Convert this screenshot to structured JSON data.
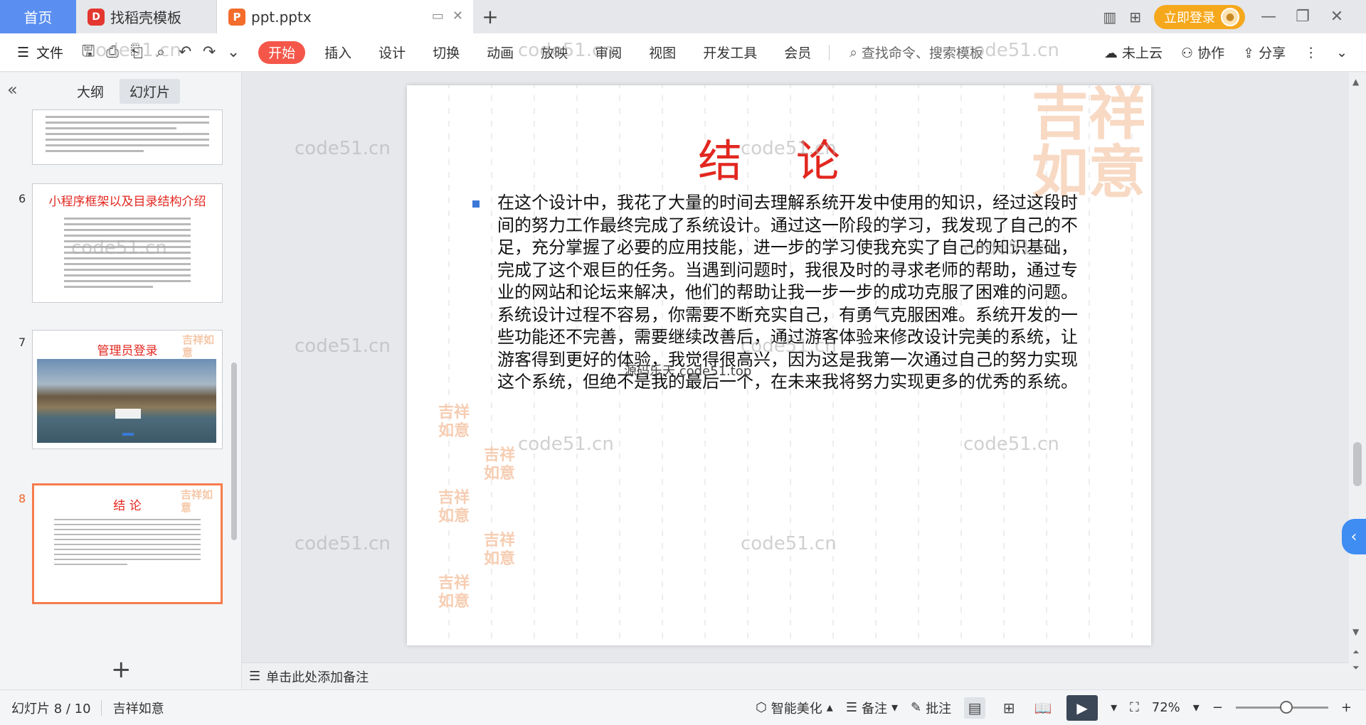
{
  "tabbar": {
    "home": "首页",
    "tab1": "找稻壳模板",
    "tab2": "ppt.pptx",
    "login": "立即登录"
  },
  "ribbon": {
    "file": "文件",
    "tabs": [
      "开始",
      "插入",
      "设计",
      "切换",
      "动画",
      "放映",
      "审阅",
      "视图",
      "开发工具",
      "会员"
    ],
    "search_placeholder": "查找命令、搜索模板",
    "cloud": "未上云",
    "collab": "协作",
    "share": "分享"
  },
  "leftpanel": {
    "tab_outline": "大纲",
    "tab_slides": "幻灯片",
    "thumbs": [
      {
        "num": "6",
        "title": "小程序框架以及目录结构介绍"
      },
      {
        "num": "7",
        "title": "管理员登录"
      },
      {
        "num": "8",
        "title": "结 论"
      }
    ]
  },
  "slide": {
    "title": "结 论",
    "body": "在这个设计中，我花了大量的时间去理解系统开发中使用的知识，经过这段时间的努力工作最终完成了系统设计。通过这一阶段的学习，我发现了自己的不足，充分掌握了必要的应用技能，进一步的学习使我充实了自己的知识基础，完成了这个艰巨的任务。当遇到问题时，我很及时的寻求老师的帮助，通过专业的网站和论坛来解决，他们的帮助让我一步一步的成功克服了困难的问题。系统设计过程不容易，你需要不断充实自己，有勇气克服困难。系统开发的一些功能还不完善，需要继续改善后，通过游客体验来修改设计完美的系统，让游客得到更好的体验，我觉得很高兴，因为这是我第一次通过自己的努力实现这个系统，但绝不是我的最后一个，在未来我将努力实现更多的优秀的系统。",
    "stamp": "吉祥如意",
    "overlay_text": "源码乐天 code51.top"
  },
  "notes": {
    "placeholder": "单击此处添加备注"
  },
  "statusbar": {
    "slide_count": "幻灯片 8 / 10",
    "theme": "吉祥如意",
    "beautify": "智能美化",
    "notes": "备注",
    "comment": "批注",
    "zoom": "72%"
  },
  "watermark": "code51.cn",
  "colors": {
    "accent": "#f4574a",
    "title_red": "#e2271f",
    "home_tab": "#5a8ff1",
    "login": "#f6a81d"
  }
}
